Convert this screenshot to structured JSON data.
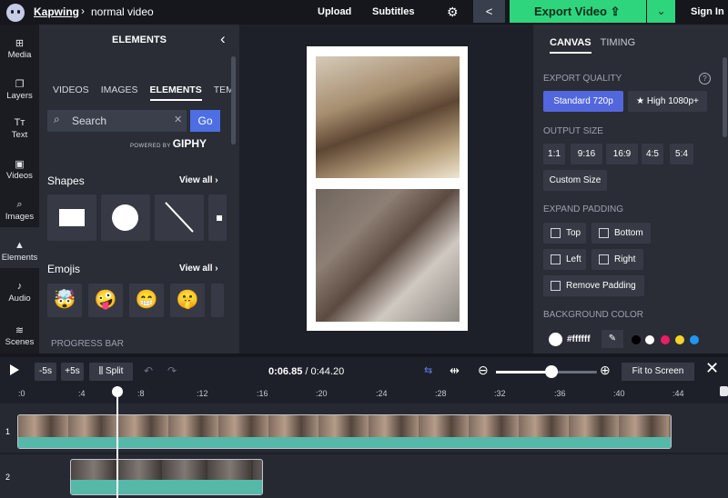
{
  "topbar": {
    "brand": "Kapwing",
    "crumb_sep": "›",
    "project": "normal video",
    "upload": "Upload",
    "subtitles": "Subtitles",
    "gear_icon": "⚙",
    "share_icon": "<",
    "export": "Export Video",
    "export_dd": "⌄",
    "signin": "Sign In"
  },
  "rail": [
    "Media",
    "Layers",
    "Text",
    "Videos",
    "Images",
    "Elements",
    "Audio",
    "Scenes"
  ],
  "panel": {
    "title": "ELEMENTS",
    "close": "‹",
    "tabs": [
      "VIDEOS",
      "IMAGES",
      "ELEMENTS",
      "TEM"
    ],
    "search_placeholder": "Search",
    "search_clear": "✕",
    "go": "Go",
    "powered": "POWERED BY",
    "giphy": "GIPHY",
    "shapes": "Shapes",
    "emojis": "Emojis",
    "view_all": "View all ›",
    "progress_bar": "PROGRESS BAR"
  },
  "emoji_glyphs": [
    "🤯",
    "🤪",
    "😁",
    "🤫"
  ],
  "right": {
    "tab_canvas": "CANVAS",
    "tab_timing": "TIMING",
    "export_quality": "EXPORT QUALITY",
    "help": "?",
    "q_standard": "Standard 720p",
    "q_high": "★ High 1080p+",
    "output_size": "OUTPUT SIZE",
    "sizes": [
      "1:1",
      "9:16",
      "16:9",
      "4:5",
      "5:4"
    ],
    "custom_size": "Custom Size",
    "expand_padding": "EXPAND PADDING",
    "pad": [
      "Top",
      "Bottom",
      "Left",
      "Right"
    ],
    "remove_padding": "Remove Padding",
    "background_color": "BACKGROUND COLOR",
    "bg_hex": "#ffffff",
    "swatches": [
      "#000000",
      "#ffffff",
      "#e91e63",
      "#f5d327",
      "#2196f3"
    ]
  },
  "controls": {
    "minus5": "-5s",
    "plus5": "+5s",
    "split": "Split",
    "undo": "↶",
    "redo": "↷",
    "current": "0:06.85",
    "total": "/ 0:44.20",
    "fit": "Fit to Screen",
    "close": "✕",
    "zoom_level": 0.55
  },
  "ruler": [
    ":0",
    ":4",
    ":8",
    ":12",
    ":16",
    ":20",
    ":24",
    ":28",
    ":32",
    ":36",
    ":40",
    ":44"
  ],
  "tracks": [
    "1",
    "2"
  ]
}
